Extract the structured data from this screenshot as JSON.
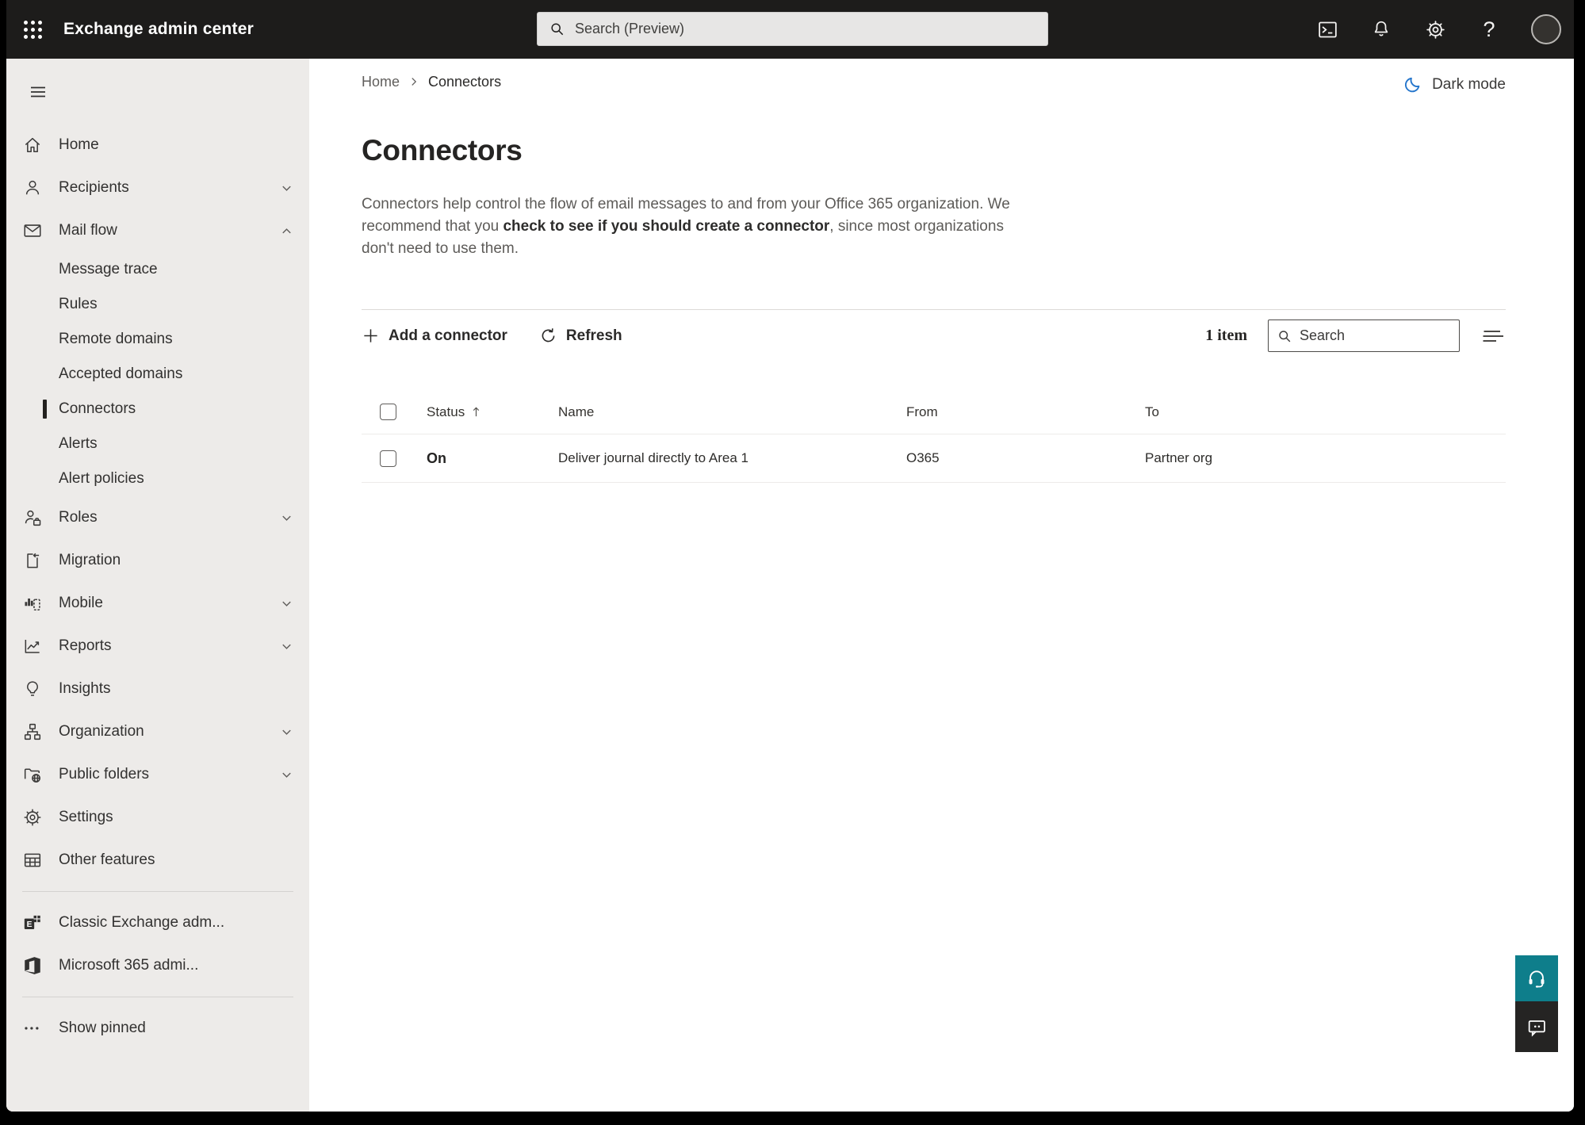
{
  "topbar": {
    "app_title": "Exchange admin center",
    "search_placeholder": "Search (Preview)"
  },
  "sidebar": {
    "items": [
      {
        "label": "Home"
      },
      {
        "label": "Recipients"
      },
      {
        "label": "Mail flow"
      },
      {
        "label": "Message trace"
      },
      {
        "label": "Rules"
      },
      {
        "label": "Remote domains"
      },
      {
        "label": "Accepted domains"
      },
      {
        "label": "Connectors",
        "selected": true
      },
      {
        "label": "Alerts"
      },
      {
        "label": "Alert policies"
      },
      {
        "label": "Roles"
      },
      {
        "label": "Migration"
      },
      {
        "label": "Mobile"
      },
      {
        "label": "Reports"
      },
      {
        "label": "Insights"
      },
      {
        "label": "Organization"
      },
      {
        "label": "Public folders"
      },
      {
        "label": "Settings"
      },
      {
        "label": "Other features"
      },
      {
        "label": "Classic Exchange adm..."
      },
      {
        "label": "Microsoft 365 admi..."
      },
      {
        "label": "Show pinned"
      }
    ]
  },
  "breadcrumb": {
    "home": "Home",
    "current": "Connectors"
  },
  "theme_toggle": {
    "label": "Dark mode"
  },
  "page": {
    "title": "Connectors",
    "description_before": "Connectors help control the flow of email messages to and from your Office 365 organization. We recommend that you ",
    "description_link": "check to see if you should create a connector",
    "description_after": ", since most organizations don't need to use them."
  },
  "toolbar": {
    "add_label": "Add a connector",
    "refresh_label": "Refresh",
    "item_count": "1 item",
    "search_placeholder": "Search"
  },
  "table": {
    "headers": {
      "status": "Status",
      "name": "Name",
      "from": "From",
      "to": "To"
    },
    "rows": [
      {
        "status": "On",
        "name": "Deliver journal directly to Area 1",
        "from": "O365",
        "to": "Partner org"
      }
    ]
  },
  "colors": {
    "topbar_bg": "#1d1c1b",
    "sidebar_bg": "#edebe9",
    "accent_teal": "#0e7e8b",
    "moon_blue": "#2576cc"
  }
}
